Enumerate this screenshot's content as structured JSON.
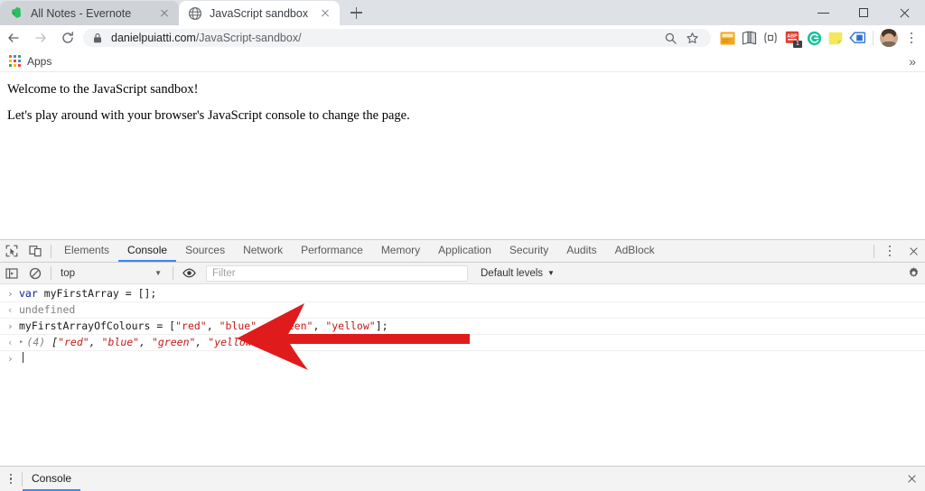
{
  "window": {
    "controls": {
      "minimize": "minimize-icon",
      "maximize": "maximize-icon",
      "close": "close-icon"
    }
  },
  "tabs": [
    {
      "title": "All Notes - Evernote",
      "favicon": "evernote-icon",
      "active": false
    },
    {
      "title": "JavaScript sandbox",
      "favicon": "globe-icon",
      "active": true
    }
  ],
  "newtab_label": "+",
  "toolbar": {
    "back": "back-arrow-icon",
    "forward": "forward-arrow-icon",
    "reload": "reload-icon",
    "lock": "lock-icon",
    "url_host": "danielpuiatti.com",
    "url_path": "/JavaScript-sandbox/",
    "url_full": "danielpuiatti.com/JavaScript-sandbox/",
    "zoom_search": "search-icon",
    "bookmark_star": "star-icon",
    "extensions": [
      {
        "name": "sticky-note-extension",
        "color": "#f5a623"
      },
      {
        "name": "book-extension",
        "color": "#55595e"
      },
      {
        "name": "brackets-extension",
        "color": "#5f6368"
      },
      {
        "name": "adblock-extension",
        "color": "#e03b2f",
        "badge": "1"
      },
      {
        "name": "grammarly-extension",
        "color": "#15c39a"
      },
      {
        "name": "notes-extension",
        "color": "#f2e85c"
      },
      {
        "name": "translate-extension",
        "color": "#2f6fd0"
      }
    ],
    "profile": "avatar",
    "menu": "kebab-menu-icon"
  },
  "bookmarks": {
    "apps_label": "Apps",
    "apps_icon": "apps-grid-icon",
    "overflow": "»"
  },
  "page": {
    "heading_line": "Welcome to the JavaScript sandbox!",
    "body_line": "Let's play around with your browser's JavaScript console to change the page."
  },
  "devtools": {
    "inspect_icon": "inspect-element-icon",
    "device_icon": "device-toolbar-icon",
    "tabs": [
      {
        "label": "Elements",
        "selected": false
      },
      {
        "label": "Console",
        "selected": true
      },
      {
        "label": "Sources",
        "selected": false
      },
      {
        "label": "Network",
        "selected": false
      },
      {
        "label": "Performance",
        "selected": false
      },
      {
        "label": "Memory",
        "selected": false
      },
      {
        "label": "Application",
        "selected": false
      },
      {
        "label": "Security",
        "selected": false
      },
      {
        "label": "Audits",
        "selected": false
      },
      {
        "label": "AdBlock",
        "selected": false
      }
    ],
    "more_icon": "kebab-menu-icon",
    "close_icon": "close-icon",
    "filterbar": {
      "sidebar_icon": "console-sidebar-icon",
      "clear_icon": "clear-console-icon",
      "context": "top",
      "context_caret": "▼",
      "eye_icon": "live-expression-eye-icon",
      "filter_placeholder": "Filter",
      "filter_value": "",
      "levels_label": "Default levels",
      "levels_caret": "▼",
      "settings_icon": "gear-icon"
    },
    "console": {
      "input_marker": "›",
      "output_marker": "‹",
      "expand_triangle": "▸",
      "messages": [
        {
          "kind": "input",
          "parts": [
            {
              "t": "var ",
              "c": "kw"
            },
            {
              "t": "myFirstArray ",
              "c": "ident"
            },
            {
              "t": "= [];",
              "c": "punc"
            }
          ]
        },
        {
          "kind": "output",
          "parts": [
            {
              "t": "undefined",
              "c": "undef"
            }
          ]
        },
        {
          "kind": "input",
          "parts": [
            {
              "t": "myFirstArrayOfColours = [",
              "c": "ident"
            },
            {
              "t": "\"red\"",
              "c": "str"
            },
            {
              "t": ", ",
              "c": "punc"
            },
            {
              "t": "\"blue\"",
              "c": "str"
            },
            {
              "t": ", ",
              "c": "punc"
            },
            {
              "t": "\"green\"",
              "c": "str"
            },
            {
              "t": ", ",
              "c": "punc"
            },
            {
              "t": "\"yellow\"",
              "c": "str"
            },
            {
              "t": "];",
              "c": "punc"
            }
          ]
        },
        {
          "kind": "result",
          "expandable": true,
          "parts": [
            {
              "t": "(4) ",
              "c": "arrlen"
            },
            {
              "t": "[",
              "c": "punc"
            },
            {
              "t": "\"red\"",
              "c": "str"
            },
            {
              "t": ", ",
              "c": "punc"
            },
            {
              "t": "\"blue\"",
              "c": "str"
            },
            {
              "t": ", ",
              "c": "punc"
            },
            {
              "t": "\"green\"",
              "c": "str"
            },
            {
              "t": ", ",
              "c": "punc"
            },
            {
              "t": "\"yellow\"",
              "c": "str"
            },
            {
              "t": "]",
              "c": "punc"
            }
          ]
        },
        {
          "kind": "prompt",
          "parts": []
        }
      ]
    }
  },
  "annotation": {
    "type": "arrow",
    "direction": "left",
    "color": "#e01b1b",
    "points_at": "console-result-array"
  },
  "drawer": {
    "menu_icon": "kebab-menu-icon",
    "tab_label": "Console",
    "close_icon": "close-icon"
  }
}
